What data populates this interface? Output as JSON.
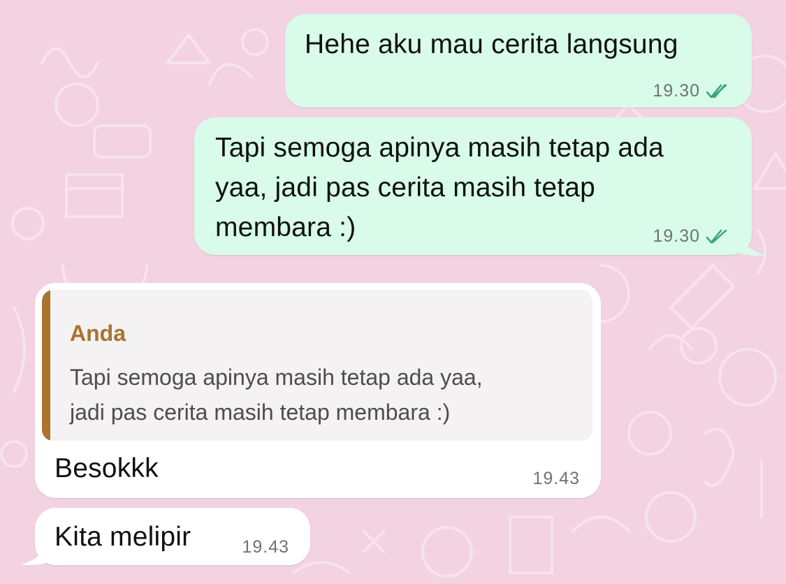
{
  "messages": [
    {
      "direction": "outgoing",
      "lines": [
        "Hehe aku mau cerita langsung"
      ],
      "time": "19.30",
      "status": "read-double-check-icon"
    },
    {
      "direction": "outgoing",
      "lines": [
        "Tapi semoga apinya masih tetap ada",
        "yaa, jadi pas cerita masih tetap",
        "membara :)"
      ],
      "time": "19.30",
      "status": "read-double-check-icon"
    },
    {
      "direction": "incoming",
      "quote": {
        "author": "Anda",
        "lines": [
          "Tapi semoga apinya masih tetap ada yaa,",
          "jadi pas cerita masih tetap membara :)"
        ]
      },
      "lines": [
        "Besokkk"
      ],
      "time": "19.43"
    },
    {
      "direction": "incoming",
      "lines": [
        "Kita melipir"
      ],
      "time": "19.43"
    }
  ],
  "colors": {
    "wallpaper": "#f3d2e1",
    "outgoing_bubble": "#d8fbea",
    "incoming_bubble": "#ffffff",
    "quote_accent": "#a87430",
    "read_ticks": "#35a57a"
  }
}
